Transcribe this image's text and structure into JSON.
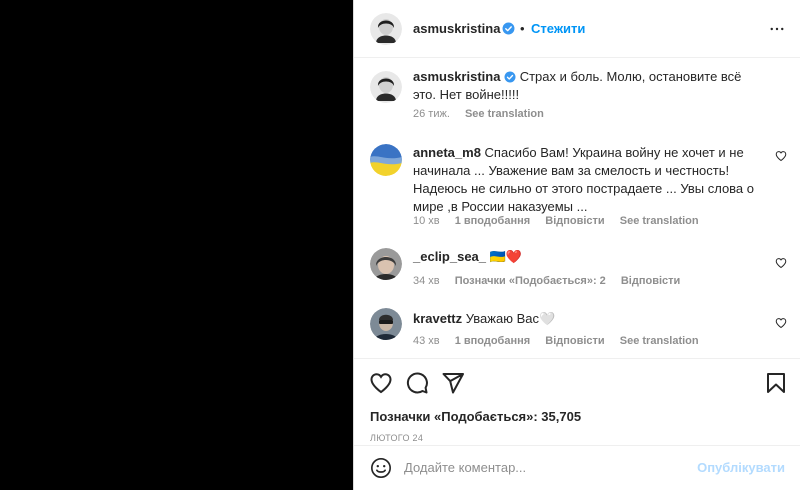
{
  "header": {
    "username": "asmuskristina",
    "separator": "•",
    "follow_label": "Стежити"
  },
  "caption": {
    "username": "asmuskristina",
    "text": "Страх и боль. Молю, остановите всё это. Нет войне!!!!!",
    "time": "26 тиж.",
    "see_translation": "See translation"
  },
  "comments": [
    {
      "username": "anneta_m8",
      "text": "Спасибо Вам! Украина войну не хочет и не начинала ... Уважение вам за смелость и честность! Надеюсь не сильно от этого пострадаете ... Увы слова о мире ,в России наказуемы ...",
      "time": "10 хв",
      "likes": "1 вподобання",
      "reply": "Відповісти",
      "see_translation": "See translation"
    },
    {
      "username": "_eclip_sea_",
      "text": "🇺🇦❤️",
      "time": "34 хв",
      "likes": "Позначки «Подобається»: 2",
      "reply": "Відповісти"
    },
    {
      "username": "kravettz",
      "text": "Уважаю Вас🤍",
      "time": "43 хв",
      "likes": "1 вподобання",
      "reply": "Відповісти",
      "see_translation": "See translation"
    }
  ],
  "post": {
    "likes_text": "Позначки «Подобається»: 35,705",
    "date": "ЛЮТОГО 24"
  },
  "add_comment": {
    "placeholder": "Додайте коментар...",
    "publish_label": "Опублікувати"
  },
  "icons": {
    "verified": "verified-badge-icon",
    "more": "more-options-icon",
    "like": "heart-icon",
    "comment": "comment-icon",
    "share": "share-icon",
    "save": "bookmark-icon",
    "emoji": "emoji-icon"
  },
  "colors": {
    "link": "#0095f6",
    "muted": "#8e8e8e",
    "publish_disabled": "#b3dbff"
  }
}
